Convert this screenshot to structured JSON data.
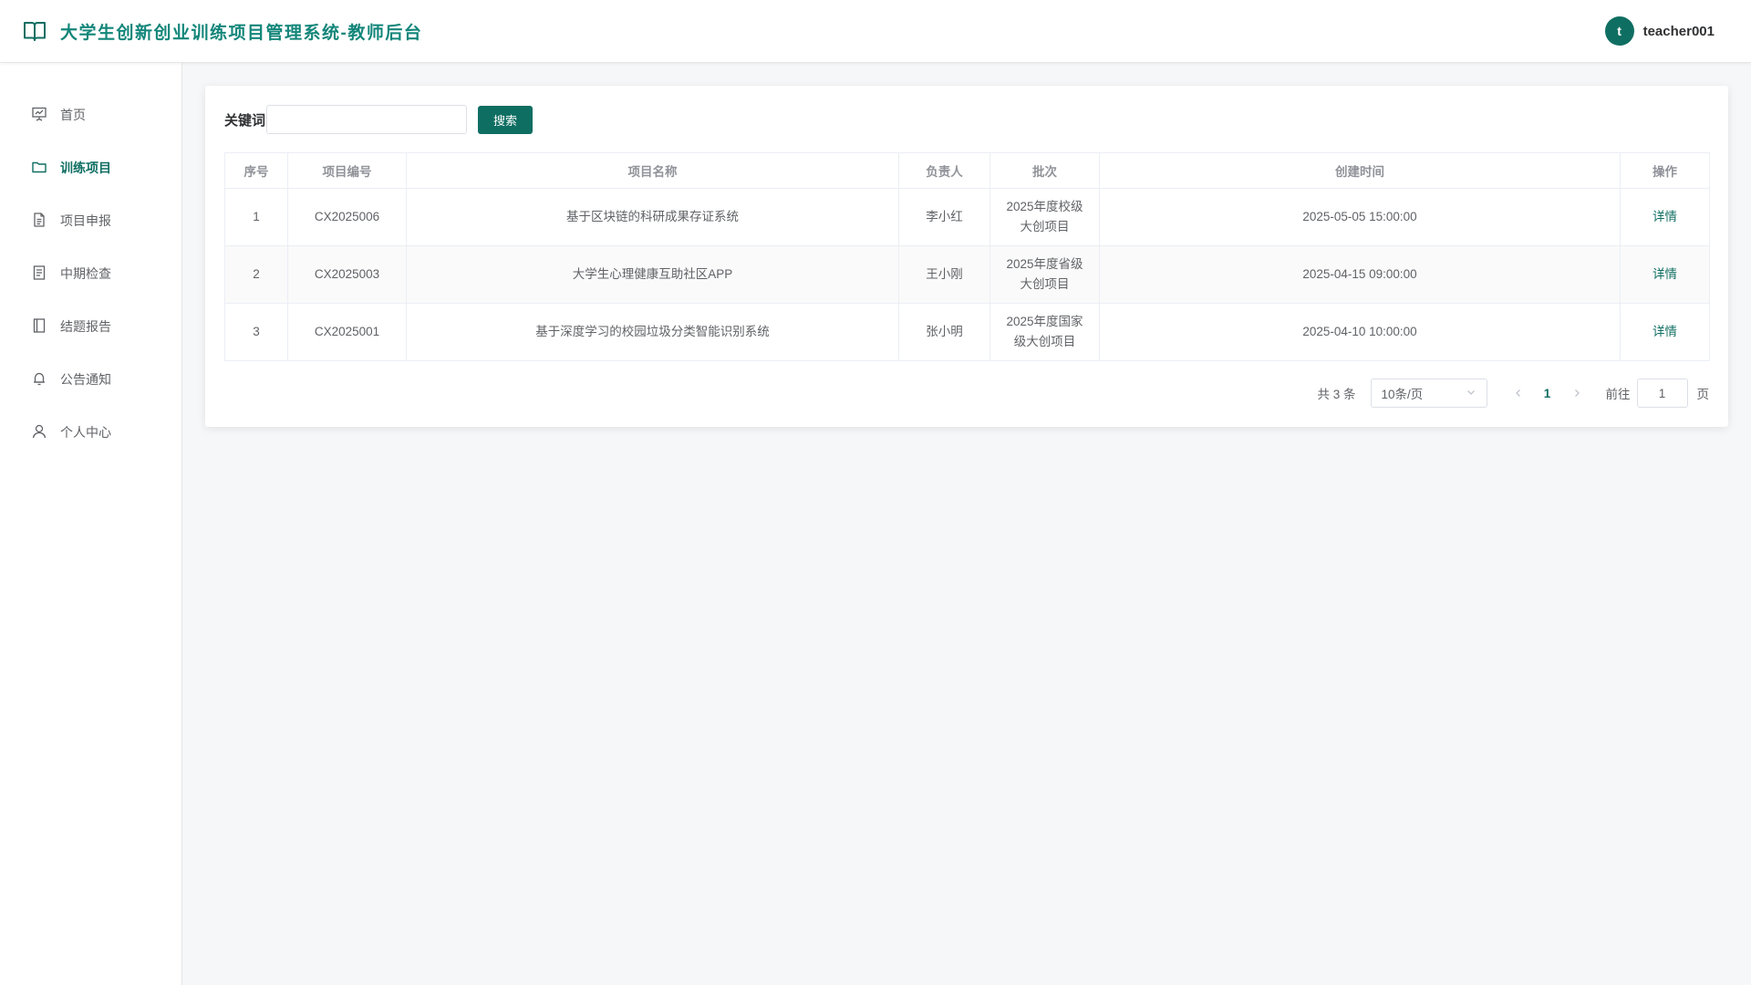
{
  "colors": {
    "primary": "#0f6e62",
    "title": "#13867a"
  },
  "header": {
    "title": "大学生创新创业训练项目管理系统-教师后台",
    "avatar_letter": "t",
    "username": "teacher001"
  },
  "sidebar": {
    "items": [
      {
        "label": "首页",
        "icon": "presentation-icon",
        "active": false
      },
      {
        "label": "训练项目",
        "icon": "folder-icon",
        "active": true
      },
      {
        "label": "项目申报",
        "icon": "document-icon",
        "active": false
      },
      {
        "label": "中期检查",
        "icon": "checklist-icon",
        "active": false
      },
      {
        "label": "结题报告",
        "icon": "book-icon",
        "active": false
      },
      {
        "label": "公告通知",
        "icon": "bell-icon",
        "active": false
      },
      {
        "label": "个人中心",
        "icon": "user-icon",
        "active": false
      }
    ]
  },
  "search": {
    "label": "关键词",
    "value": "",
    "placeholder": "",
    "button": "搜索"
  },
  "table": {
    "columns": [
      "序号",
      "项目编号",
      "项目名称",
      "负责人",
      "批次",
      "创建时间",
      "操作"
    ],
    "rows": [
      {
        "index": "1",
        "code": "CX2025006",
        "name": "基于区块链的科研成果存证系统",
        "leader": "李小红",
        "batch": "2025年度校级大创项目",
        "created": "2025-05-05 15:00:00",
        "action": "详情"
      },
      {
        "index": "2",
        "code": "CX2025003",
        "name": "大学生心理健康互助社区APP",
        "leader": "王小刚",
        "batch": "2025年度省级大创项目",
        "created": "2025-04-15 09:00:00",
        "action": "详情"
      },
      {
        "index": "3",
        "code": "CX2025001",
        "name": "基于深度学习的校园垃圾分类智能识别系统",
        "leader": "张小明",
        "batch": "2025年度国家级大创项目",
        "created": "2025-04-10 10:00:00",
        "action": "详情"
      }
    ]
  },
  "pagination": {
    "total_text": "共 3 条",
    "page_size": "10条/页",
    "current_page": "1",
    "goto_label": "前往",
    "goto_value": "1",
    "page_unit": "页"
  }
}
